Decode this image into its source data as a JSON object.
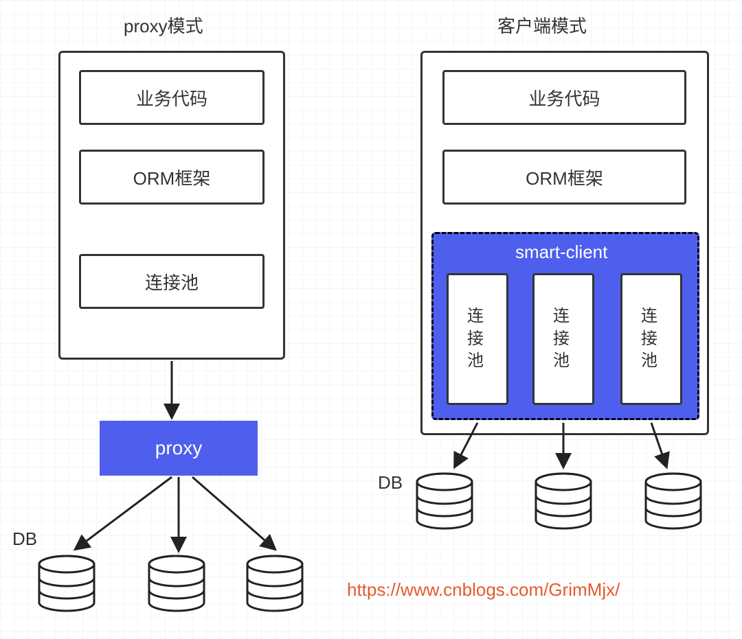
{
  "left": {
    "title": "proxy模式",
    "boxes": {
      "business": "业务代码",
      "orm": "ORM框架",
      "pool": "连接池"
    },
    "proxy_label": "proxy",
    "db_label": "DB"
  },
  "right": {
    "title": "客户端模式",
    "boxes": {
      "business": "业务代码",
      "orm": "ORM框架"
    },
    "smart_client_label": "smart-client",
    "pools": [
      "连\n接\n池",
      "连\n接\n池",
      "连\n接\n池"
    ],
    "db_label": "DB"
  },
  "footer_link": "https://www.cnblogs.com/GrimMjx/"
}
